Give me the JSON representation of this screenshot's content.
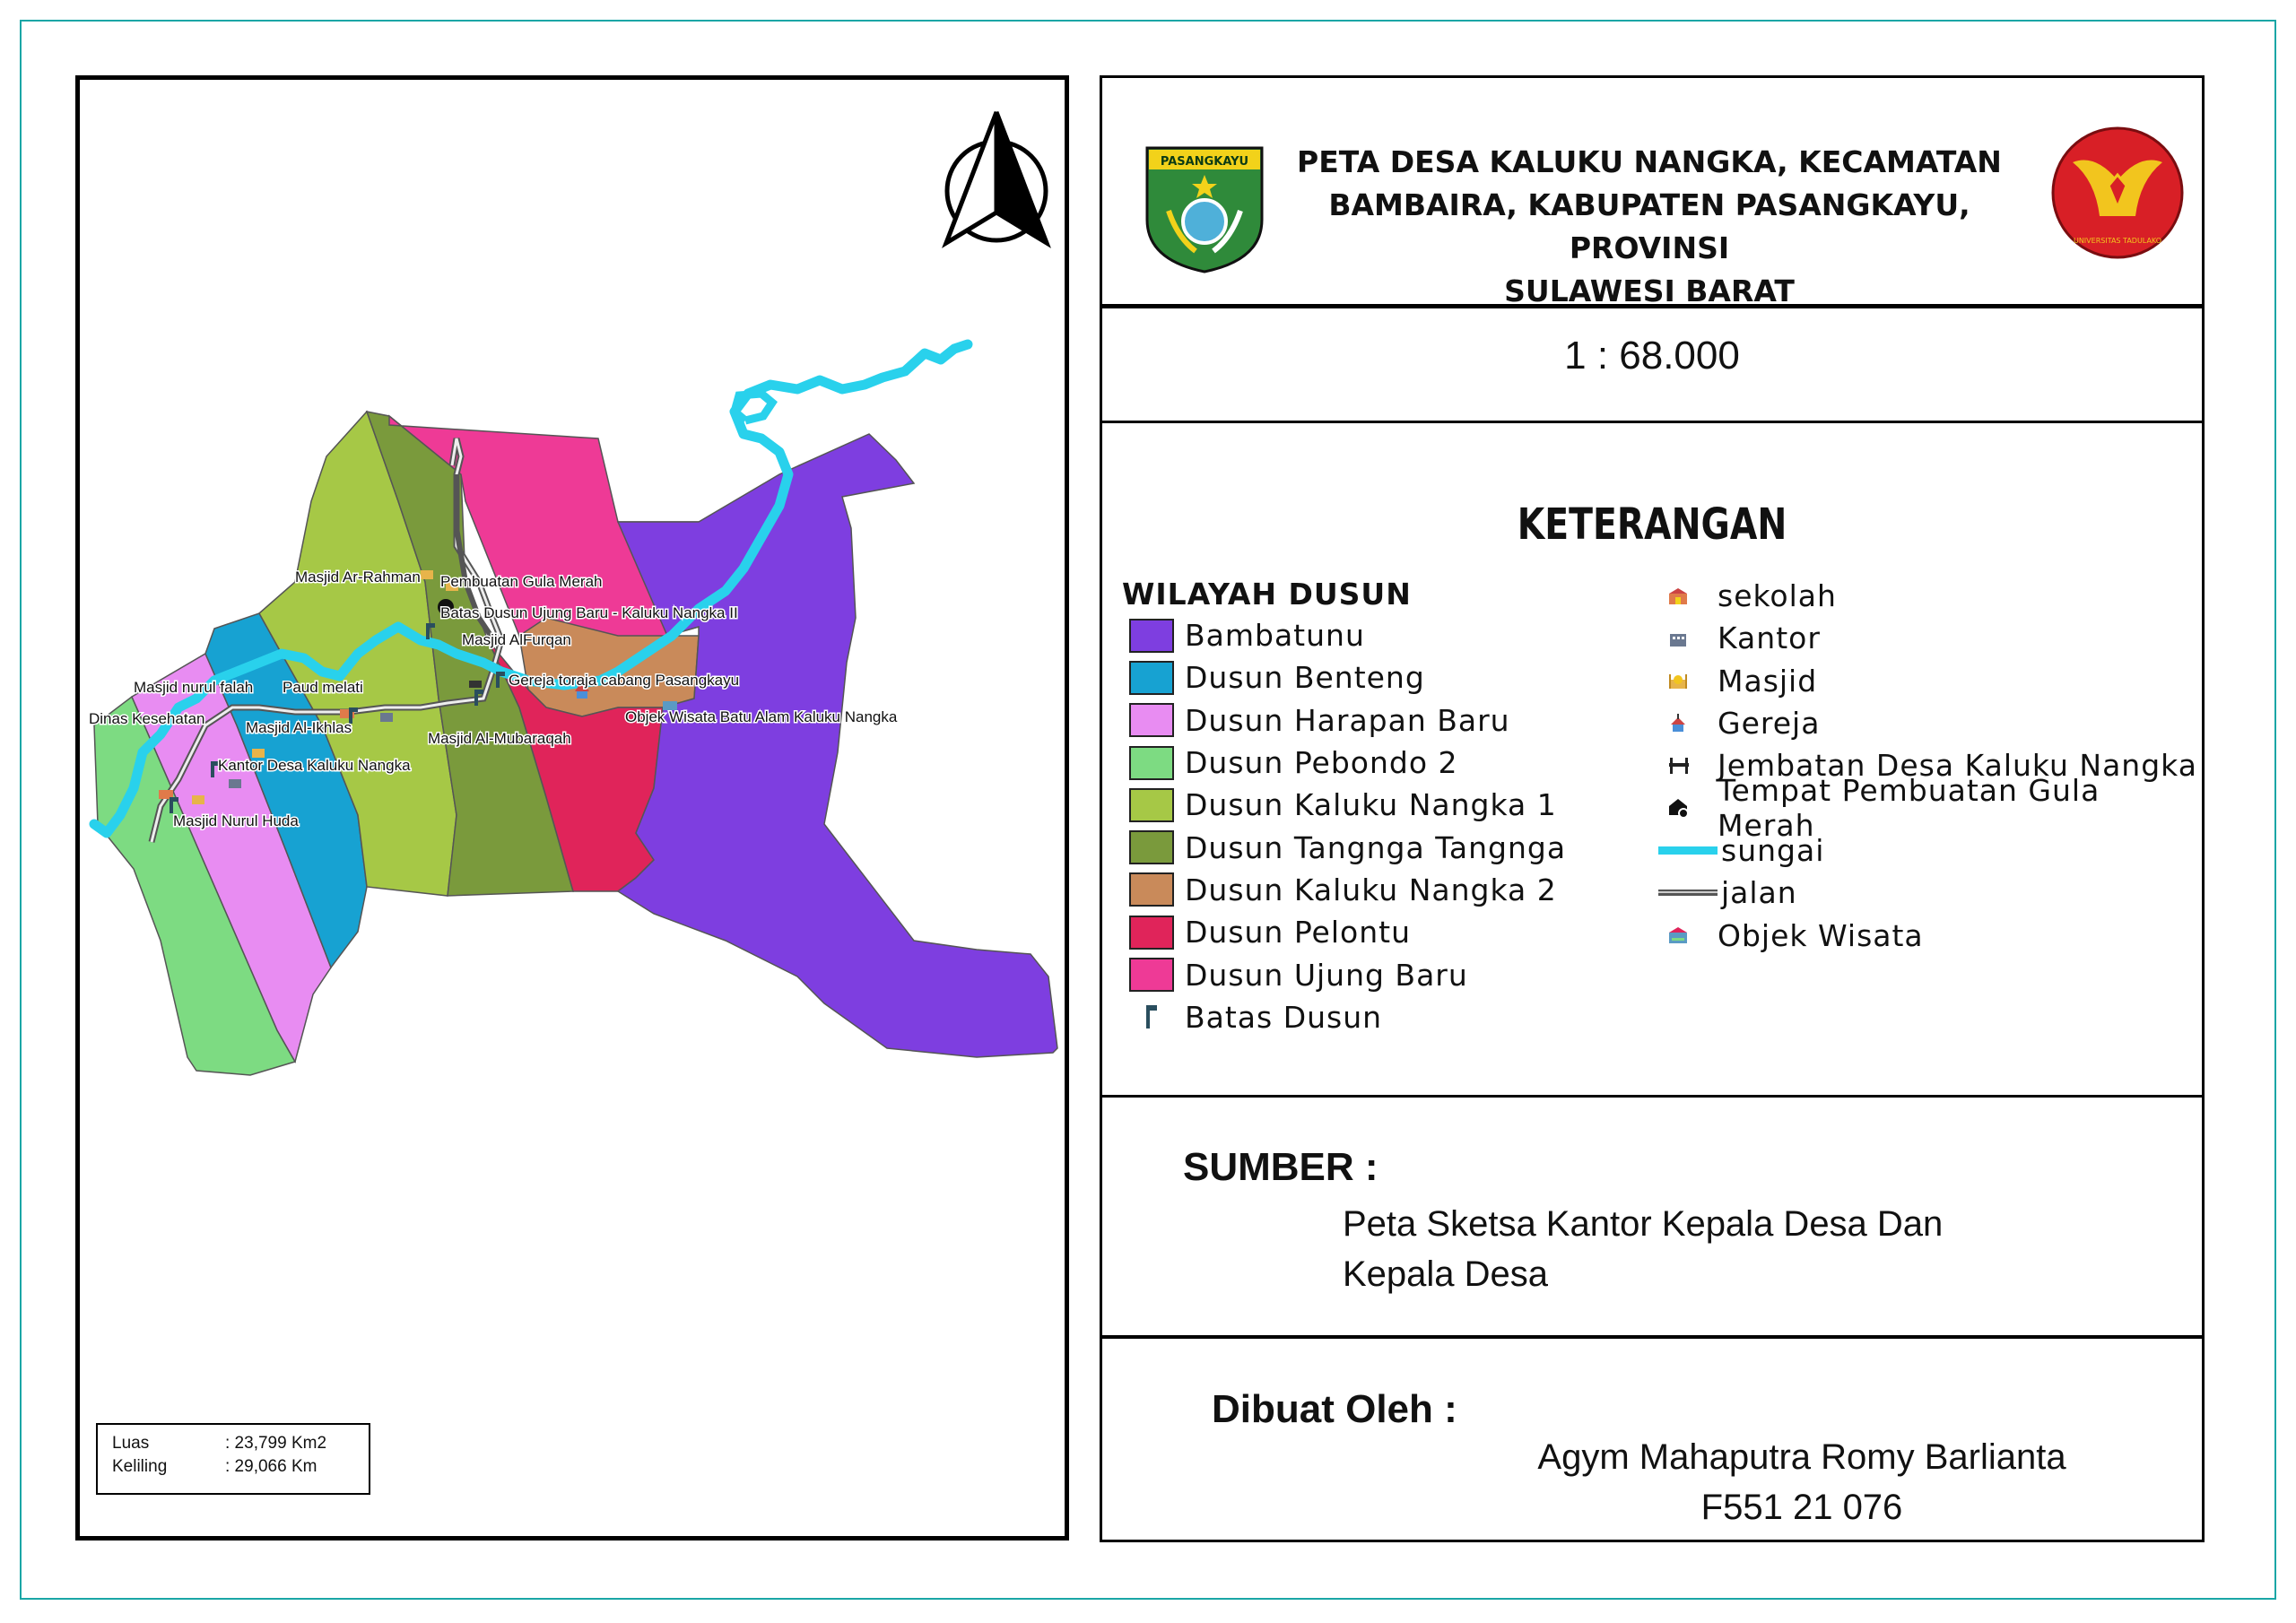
{
  "title": {
    "line1": "PETA DESA KALUKU NANGKA, KECAMATAN",
    "line2": "BAMBAIRA, KABUPATEN PASANGKAYU, PROVINSI",
    "line3": "SULAWESI BARAT"
  },
  "logo_left_text": "PASANGKAYU",
  "logo_right_text": "UNIVERSITAS TADULAKO",
  "scale": "1 : 68.000",
  "legend_title": "KETERANGAN",
  "dusun_heading": "WILAYAH DUSUN",
  "dusun": [
    {
      "label": "Bambatunu",
      "color": "#7e3ee0"
    },
    {
      "label": "Dusun Benteng",
      "color": "#17a2d2"
    },
    {
      "label": "Dusun Harapan Baru",
      "color": "#e88cf2"
    },
    {
      "label": "Dusun Pebondo 2",
      "color": "#7ddb82"
    },
    {
      "label": "Dusun Kaluku Nangka 1",
      "color": "#a6c846"
    },
    {
      "label": "Dusun Tangnga Tangnga",
      "color": "#7a9a3c"
    },
    {
      "label": "Dusun Kaluku Nangka 2",
      "color": "#c98a5a"
    },
    {
      "label": "Dusun Pelontu",
      "color": "#e0245a"
    },
    {
      "label": "Dusun Ujung Baru",
      "color": "#ee3a96"
    }
  ],
  "batas_label": "Batas Dusun",
  "symbols": [
    {
      "label": "sekolah",
      "icon": "school-icon"
    },
    {
      "label": "Kantor",
      "icon": "office-icon"
    },
    {
      "label": "Masjid",
      "icon": "mosque-icon"
    },
    {
      "label": "Gereja",
      "icon": "church-icon"
    },
    {
      "label": "Jembatan Desa Kaluku Nangka",
      "icon": "bridge-icon"
    },
    {
      "label": "Tempat Pembuatan Gula Merah",
      "icon": "factory-icon"
    },
    {
      "label": "sungai",
      "icon": "river-line"
    },
    {
      "label": "jalan",
      "icon": "road-line"
    },
    {
      "label": "Objek Wisata",
      "icon": "tourism-icon"
    }
  ],
  "sumber_heading": "SUMBER :",
  "sumber_text_1": "Peta Sketsa Kantor Kepala Desa Dan",
  "sumber_text_2": "Kepala Desa",
  "made_by_heading": "Dibuat Oleh :",
  "author": "Agym Mahaputra Romy Barlianta",
  "author_id": "F551 21 076",
  "map_info": {
    "luas_key": "Luas",
    "luas_value": ": 23,799 Km2",
    "keliling_key": "Keliling",
    "keliling_value": ": 29,066 Km"
  },
  "map_labels": {
    "ar_rahman": "Masjid Ar-Rahman",
    "gula_merah": "Pembuatan Gula Merah",
    "batas_ujung": "Batas Dusun Ujung Baru - Kaluku Nangka II",
    "alfurqan": "Masjid AlFurqan",
    "gereja": "Gereja toraja cabang Pasangkayu",
    "nurul_falah": "Masjid nurul falah",
    "paud": "Paud melati",
    "dinas": "Dinas Kesehatan",
    "al_ikhlas": "Masjid Al-Ikhlas",
    "wisata": "Objek Wisata Batu Alam Kaluku Nangka",
    "al_mubaraqah": "Masjid Al-Mubaraqah",
    "kantor_desa": "Kantor Desa Kaluku Nangka",
    "nurul_huda": "Masjid Nurul Huda"
  }
}
